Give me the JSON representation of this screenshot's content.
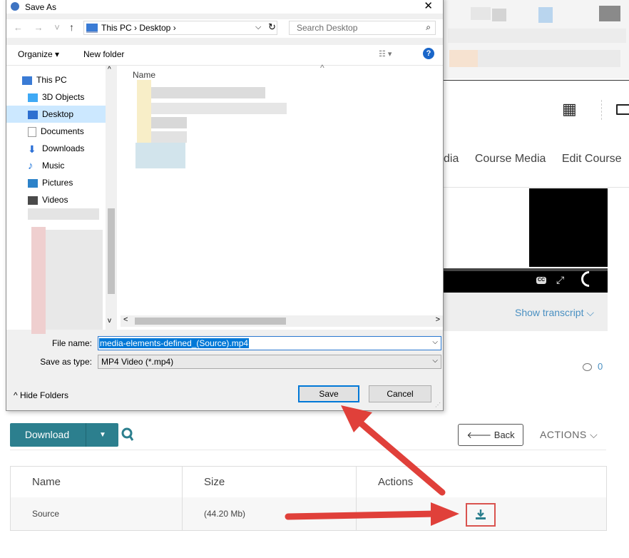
{
  "dialog": {
    "title": "Save As",
    "close_glyph": "✕",
    "nav_arrows": "← → ˅",
    "up_glyph": "↑",
    "breadcrumb": "This PC  ›  Desktop  ›",
    "addr_chevron": "⌵",
    "refresh_glyph": "↻",
    "search_placeholder": "Search Desktop",
    "search_glyph": "⌕",
    "toolbar": {
      "organize": "Organize ▾",
      "new_folder": "New folder",
      "view": "☷ ▾",
      "help": "?"
    },
    "nav_items": [
      {
        "label": "This PC",
        "icon": "this-pc-icon",
        "color": "#3a7bd5"
      },
      {
        "label": "3D Objects",
        "icon": "3d-objects-icon",
        "color": "#3fa9f5"
      },
      {
        "label": "Desktop",
        "icon": "desktop-icon",
        "color": "#2d6fd0",
        "selected": true
      },
      {
        "label": "Documents",
        "icon": "documents-icon",
        "color": "#b0b0b0"
      },
      {
        "label": "Downloads",
        "icon": "downloads-icon",
        "color": "#2a6fd6"
      },
      {
        "label": "Music",
        "icon": "music-icon",
        "color": "#1a72d9"
      },
      {
        "label": "Pictures",
        "icon": "pictures-icon",
        "color": "#2c82c9"
      },
      {
        "label": "Videos",
        "icon": "videos-icon",
        "color": "#4a4a4a"
      }
    ],
    "scroll_up": "^",
    "scroll_down": "v",
    "file_list_header": "Name",
    "sort_glyph": "^",
    "hscroll_left": "<",
    "hscroll_right": ">",
    "file_name_label": "File name:",
    "file_name_value": "media-elements-defined_(Source).mp4",
    "save_type_label": "Save as type:",
    "save_type_value": "MP4 Video (*.mp4)",
    "dropdown_glyph": "⌵",
    "hide_folders": "^  Hide Folders",
    "save_button": "Save",
    "cancel_button": "Cancel",
    "grip": "⋰"
  },
  "page": {
    "apps_glyph": "▦",
    "nav_items": [
      "dia",
      "Course Media",
      "Edit Course"
    ],
    "video_controls": {
      "cc": "CC",
      "expand": "⤢"
    },
    "show_transcript": "Show transcript  ⌵",
    "comment_count": "0",
    "download_button": "Download",
    "download_caret": "▼",
    "back_button": "🡐 Back",
    "actions_menu": "ACTIONS  ⌵",
    "table": {
      "headers": [
        "Name",
        "Size",
        "Actions"
      ],
      "rows": [
        {
          "name": "Source",
          "size": "(44.20 Mb)"
        }
      ]
    }
  },
  "colors": {
    "accent_teal": "#2c7f8e",
    "arrow_red": "#e0403a",
    "link_blue": "#4a90c2",
    "selection_blue": "#0078d7"
  }
}
